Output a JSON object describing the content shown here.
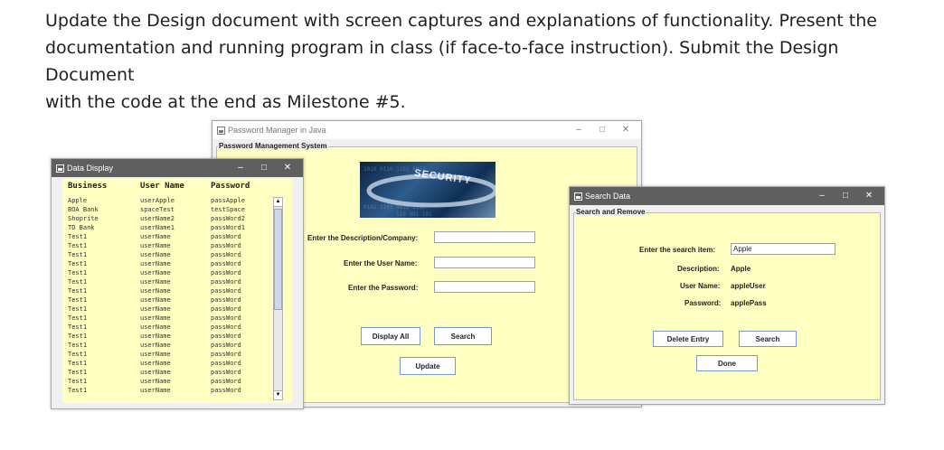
{
  "doc": {
    "line1": "Update the Design document with screen captures and explanations of functionality. Present the",
    "line2": "documentation and running program in class (if face-to-face instruction). Submit the Design Document",
    "line3": "with the code at the end as Milestone #5."
  },
  "main_window": {
    "title": "Password Manager in Java",
    "group_label": "Password Management System",
    "banner_text": "SECURITY",
    "desc_label": "Enter the Description/Company:",
    "user_label": "Enter the User Name:",
    "pass_label": "Enter the Password:",
    "desc_value": "",
    "user_value": "",
    "pass_value": "",
    "display_all": "Display All",
    "search": "Search",
    "update": "Update",
    "min": "–",
    "max": "□",
    "close": "✕"
  },
  "data_window": {
    "title": "Data Display",
    "min": "–",
    "max": "□",
    "close": "✕",
    "headers": [
      "Business",
      "User Name",
      "Password"
    ],
    "rows": [
      [
        "Apple",
        "userApple",
        "passApple"
      ],
      [
        "BOA Bank",
        "spaceTest",
        "testSpace"
      ],
      [
        "Shoprite",
        "userName2",
        "passWord2"
      ],
      [
        "TD Bank",
        "userName1",
        "passWord1"
      ],
      [
        "Test1",
        "userName",
        "passWord"
      ],
      [
        "Test1",
        "userName",
        "passWord"
      ],
      [
        "Test1",
        "userName",
        "passWord"
      ],
      [
        "Test1",
        "userName",
        "passWord"
      ],
      [
        "Test1",
        "userName",
        "passWord"
      ],
      [
        "Test1",
        "userName",
        "passWord"
      ],
      [
        "Test1",
        "userName",
        "passWord"
      ],
      [
        "Test1",
        "userName",
        "passWord"
      ],
      [
        "Test1",
        "userName",
        "passWord"
      ],
      [
        "Test1",
        "userName",
        "passWord"
      ],
      [
        "Test1",
        "userName",
        "passWord"
      ],
      [
        "Test1",
        "userName",
        "passWord"
      ],
      [
        "Test1",
        "userName",
        "passWord"
      ],
      [
        "Test1",
        "userName",
        "passWord"
      ],
      [
        "Test1",
        "userName",
        "passWord"
      ],
      [
        "Test1",
        "userName",
        "passWord"
      ],
      [
        "Test1",
        "userName",
        "passWord"
      ],
      [
        "Test1",
        "userName",
        "passWord"
      ]
    ]
  },
  "search_window": {
    "title": "Search Data",
    "group_label": "Search and Remove",
    "search_label": "Enter the search item:",
    "search_value": "Apple",
    "desc_label": "Description:",
    "desc_value": "Apple",
    "user_label": "User Name:",
    "user_value": "appleUser",
    "pass_label": "Password:",
    "pass_value": "applePass",
    "delete": "Delete Entry",
    "search": "Search",
    "done": "Done",
    "min": "–",
    "max": "□",
    "close": "✕"
  },
  "colors": {
    "panel_bg": "#ffffc2",
    "window_bg": "#f0f0f0",
    "dark_titlebar": "#5f5f5f",
    "button_border": "#7a9ac8"
  }
}
